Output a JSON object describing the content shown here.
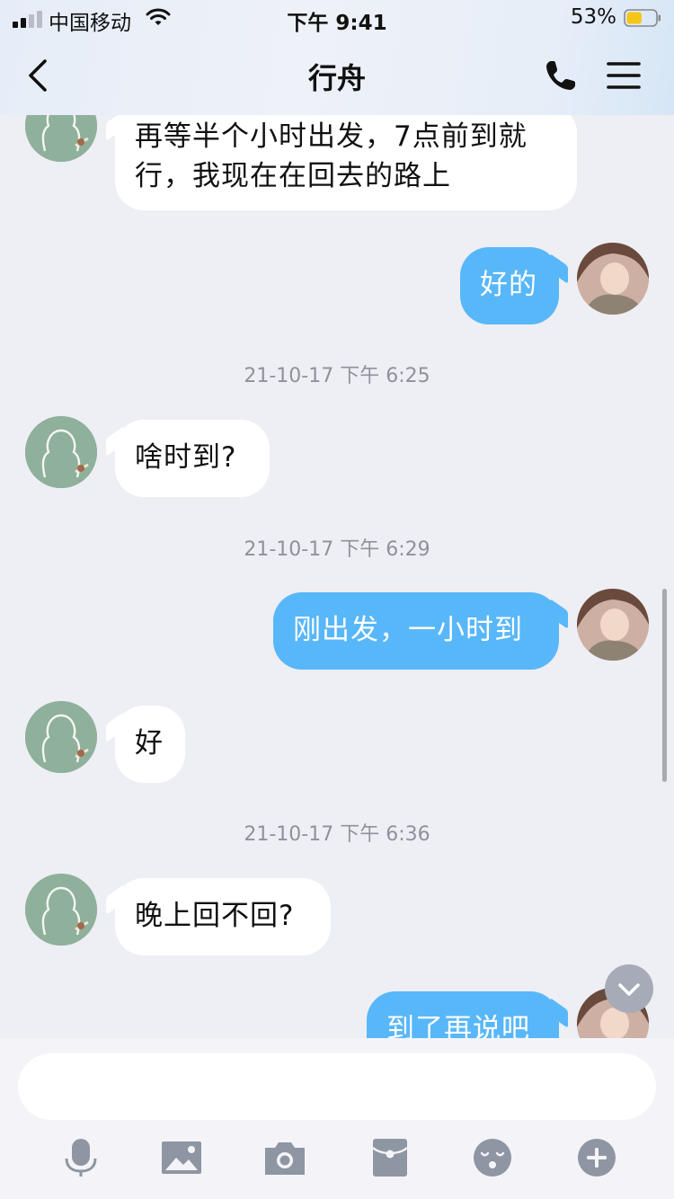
{
  "status_bar": {
    "carrier": "中国移动",
    "time": "下午 9:41",
    "battery_percent": "53%",
    "battery_level": 0.53,
    "battery_color": "#f5c518"
  },
  "header": {
    "back_icon": "chevron-left-icon",
    "title": "行舟",
    "call_icon": "phone-icon",
    "menu_icon": "menu-icon"
  },
  "colors": {
    "outgoing_bubble": "#58b7f8",
    "incoming_bubble": "#ffffff",
    "background": "#eeeef5"
  },
  "messages": [
    {
      "from": "contact",
      "text_lines": [
        "再等半个小时出发，7点前到就",
        "行，我现在在回去的路上"
      ]
    },
    {
      "from": "me",
      "text": "好的"
    },
    {
      "timestamp": "21-10-17 下午 6:25"
    },
    {
      "from": "contact",
      "text": "啥时到?"
    },
    {
      "timestamp": "21-10-17 下午 6:29"
    },
    {
      "from": "me",
      "text": "刚出发，一小时到"
    },
    {
      "from": "contact",
      "text": "好"
    },
    {
      "timestamp": "21-10-17 下午 6:36"
    },
    {
      "from": "contact",
      "text": "晚上回不回?"
    },
    {
      "from": "me",
      "text": "到了再说吧"
    }
  ],
  "scroll_down_icon": "chevron-down-icon",
  "composer": {
    "input_value": "",
    "tools": [
      "microphone-icon",
      "image-icon",
      "camera-icon",
      "red-packet-icon",
      "emoji-icon",
      "plus-icon"
    ]
  }
}
